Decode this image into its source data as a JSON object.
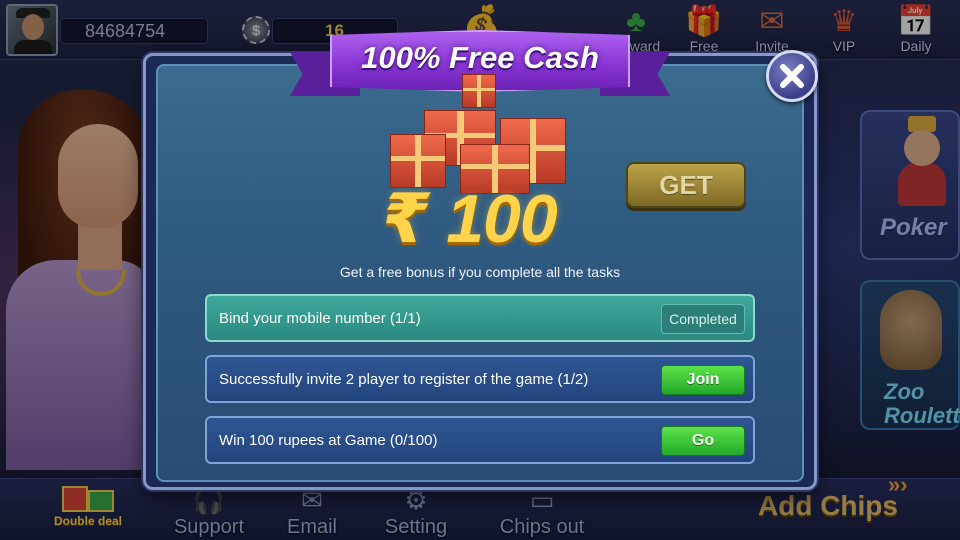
{
  "header": {
    "player_id": "84684754",
    "chips": "16",
    "icons": [
      {
        "name": "reward",
        "label": "Reward"
      },
      {
        "name": "free",
        "label": "Free"
      },
      {
        "name": "invite",
        "label": "Invite"
      },
      {
        "name": "vip",
        "label": "VIP"
      },
      {
        "name": "daily",
        "label": "Daily"
      }
    ]
  },
  "side_games": {
    "poker": "Poker",
    "zoo": "Zoo Roulette"
  },
  "bottom_bar": {
    "double_deal": "Double deal",
    "support": "Support",
    "email": "Email",
    "setting": "Setting",
    "chips_out": "Chips out",
    "add_chips": "Add Chips"
  },
  "modal": {
    "title": "100% Free Cash",
    "amount": "₹ 100",
    "get_button": "GET",
    "subtitle": "Get a free bonus if you complete all the tasks",
    "tasks": [
      {
        "text": "Bind your mobile number (1/1)",
        "action": "Completed",
        "status": "completed"
      },
      {
        "text": "Successfully invite 2 player to register of the game (1/2)",
        "action": "Join",
        "status": "pending"
      },
      {
        "text": "Win 100 rupees at Game (0/100)",
        "action": "Go",
        "status": "pending"
      }
    ]
  },
  "colors": {
    "ribbon": "#8a36d6",
    "amount": "#ffd34a",
    "task_done": "#2a8a80",
    "task_todo": "#23457d",
    "action_green": "#23a82a"
  }
}
